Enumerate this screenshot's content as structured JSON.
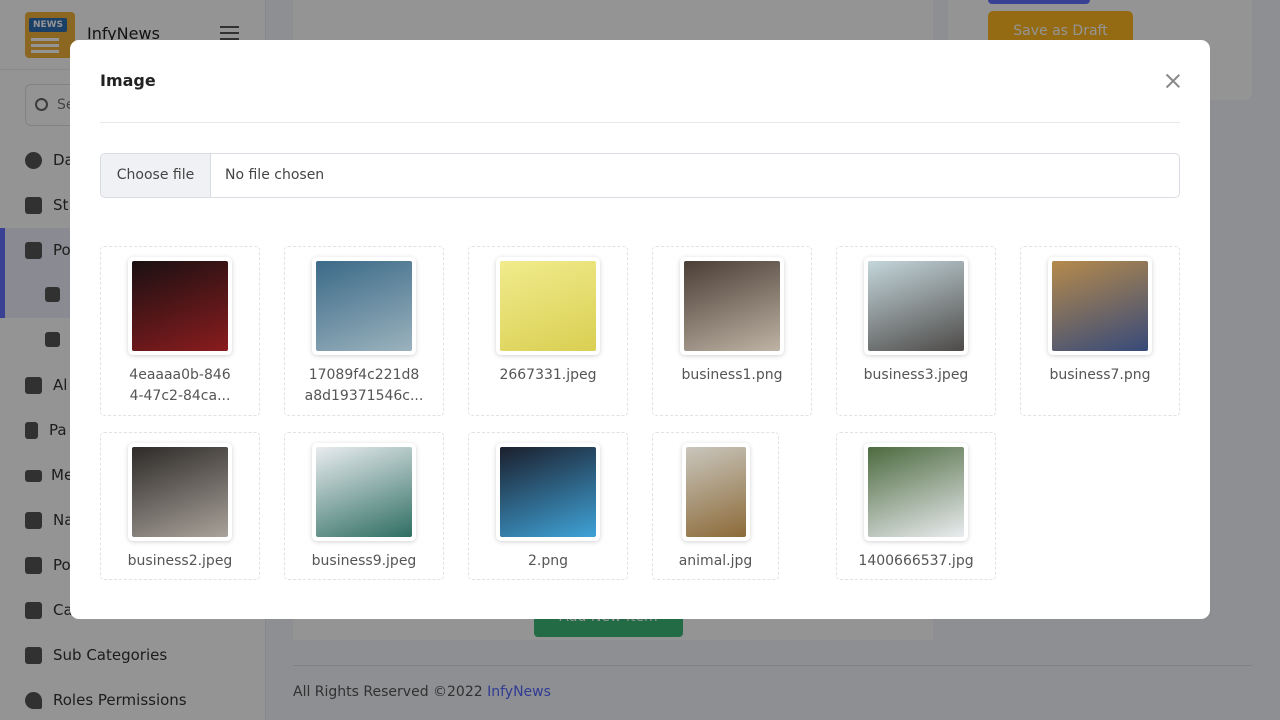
{
  "app": {
    "brand_name": "InfyNews",
    "logo_text": "NEWS",
    "search_placeholder": "Se"
  },
  "sidebar": {
    "items": [
      {
        "label": "Da",
        "icon": "dashboard-icon"
      },
      {
        "label": "St",
        "icon": "users-icon"
      },
      {
        "label": "Po",
        "icon": "posts-icon",
        "active": true
      },
      {
        "label": "",
        "icon": "copy-icon"
      },
      {
        "label": "",
        "icon": "copy-icon"
      },
      {
        "label": "Al",
        "icon": "gallery-icon"
      },
      {
        "label": "Pa",
        "icon": "file-icon"
      },
      {
        "label": "Me",
        "icon": "menu-icon"
      },
      {
        "label": "Na",
        "icon": "grid-icon"
      },
      {
        "label": "Po",
        "icon": "list-icon"
      },
      {
        "label": "Ca",
        "icon": "categories-icon"
      },
      {
        "label": "Sub Categories",
        "icon": "categories-icon"
      },
      {
        "label": "Roles Permissions",
        "icon": "key-icon"
      }
    ]
  },
  "background": {
    "save_draft_label": "Save as Draft",
    "add_item_label": "Add New Item",
    "footer_text": "All Rights Reserved ©2022",
    "footer_brand": "InfyNews"
  },
  "modal": {
    "title": "Image",
    "choose_file_label": "Choose file",
    "file_status": "No file chosen",
    "images": [
      {
        "name": "4eaaaa0b-8464-47c2-84ca...",
        "line1": "4eaaaa0b-846",
        "line2": "4-47c2-84ca...",
        "colors": [
          "#1a1012",
          "#8a1c1e"
        ]
      },
      {
        "name": "17089f4c221d8a8d19371546c...",
        "line1": "17089f4c221d8",
        "line2": "a8d19371546c...",
        "colors": [
          "#3b6a88",
          "#9bb2bd"
        ]
      },
      {
        "name": "2667331.jpeg",
        "line1": "2667331.jpeg",
        "line2": "",
        "colors": [
          "#f1eb8c",
          "#d9cf52"
        ]
      },
      {
        "name": "business1.png",
        "line1": "business1.png",
        "line2": "",
        "colors": [
          "#4a3e36",
          "#bfb3a5"
        ]
      },
      {
        "name": "business3.jpeg",
        "line1": "business3.jpeg",
        "line2": "",
        "colors": [
          "#c4d6db",
          "#4d4a48"
        ]
      },
      {
        "name": "business7.png",
        "line1": "business7.png",
        "line2": "",
        "colors": [
          "#b58a4b",
          "#374a7a"
        ]
      },
      {
        "name": "business2.jpeg",
        "line1": "business2.jpeg",
        "line2": "",
        "colors": [
          "#2d2a28",
          "#a9a29a"
        ]
      },
      {
        "name": "business9.jpeg",
        "line1": "business9.jpeg",
        "line2": "",
        "colors": [
          "#e9ecef",
          "#2f6e63"
        ]
      },
      {
        "name": "2.png",
        "line1": "2.png",
        "line2": "",
        "colors": [
          "#1b1f2d",
          "#3fa3d8"
        ]
      },
      {
        "name": "animal.jpg",
        "line1": "animal.jpg",
        "line2": "",
        "colors": [
          "#c9c6bd",
          "#8c6a38"
        ]
      },
      {
        "name": "1400666537.jpg",
        "line1": "1400666537.jpg",
        "line2": "",
        "colors": [
          "#4d6a3f",
          "#e9ecef"
        ]
      }
    ]
  },
  "colors": {
    "accent": "#6571ff",
    "draft": "#ffb820",
    "add": "#3bb878"
  }
}
